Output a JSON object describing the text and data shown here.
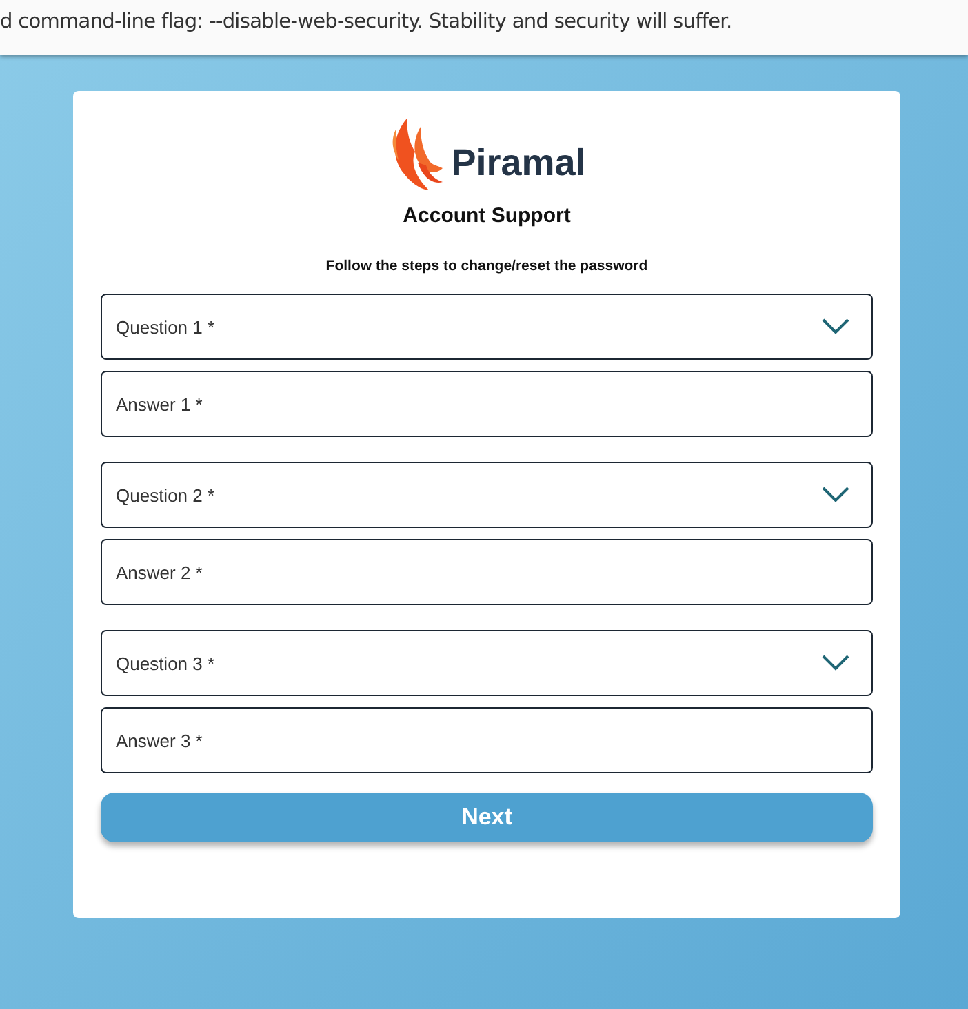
{
  "warning_bar": {
    "text": "d command-line flag: --disable-web-security. Stability and security will suffer."
  },
  "brand": {
    "name": "Piramal"
  },
  "title": "Account Support",
  "instructions": "Follow the steps to change/reset the password",
  "questions": [
    {
      "label": "Question 1 *",
      "answer_placeholder": "Answer 1 *"
    },
    {
      "label": "Question 2 *",
      "answer_placeholder": "Answer 2 *"
    },
    {
      "label": "Question 3 *",
      "answer_placeholder": "Answer 3 *"
    }
  ],
  "submit": "Next"
}
